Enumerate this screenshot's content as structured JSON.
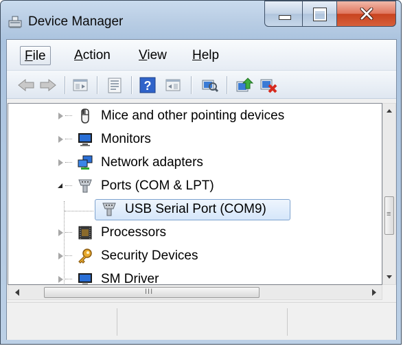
{
  "window": {
    "title": "Device Manager",
    "icon": "device-manager-icon",
    "caption_buttons": [
      "minimize",
      "maximize",
      "close"
    ]
  },
  "menu": {
    "items": [
      {
        "label": "File",
        "mnemonic": "F",
        "rest": "ile",
        "active": true
      },
      {
        "label": "Action",
        "mnemonic": "A",
        "rest": "ction",
        "active": false
      },
      {
        "label": "View",
        "mnemonic": "V",
        "rest": "iew",
        "active": false
      },
      {
        "label": "Help",
        "mnemonic": "H",
        "rest": "elp",
        "active": false
      }
    ]
  },
  "toolbar": {
    "buttons": [
      "back-icon",
      "forward-icon",
      "show-hide-console-tree-icon",
      "properties-icon",
      "help-icon",
      "show-action-pane-icon",
      "scan-hardware-icon",
      "update-driver-icon",
      "uninstall-device-icon"
    ]
  },
  "tree": {
    "nodes": [
      {
        "label": "Mice and other pointing devices",
        "icon": "mouse-icon",
        "expanded": false,
        "level": 0
      },
      {
        "label": "Monitors",
        "icon": "monitor-icon",
        "expanded": false,
        "level": 0
      },
      {
        "label": "Network adapters",
        "icon": "network-adapter-icon",
        "expanded": false,
        "level": 0
      },
      {
        "label": "Ports (COM & LPT)",
        "icon": "port-icon",
        "expanded": true,
        "level": 0
      },
      {
        "label": "USB Serial Port (COM9)",
        "icon": "port-icon",
        "expanded": null,
        "level": 1,
        "selected": true
      },
      {
        "label": "Processors",
        "icon": "processor-icon",
        "expanded": false,
        "level": 0
      },
      {
        "label": "Security Devices",
        "icon": "key-icon",
        "expanded": false,
        "level": 0
      },
      {
        "label": "SM Driver",
        "icon": "monitor-icon",
        "expanded": false,
        "level": 0
      }
    ]
  },
  "scrollbars": {
    "vertical_grip": "≡",
    "horizontal_grip": "III"
  },
  "colors": {
    "selection_border": "#7da2ce",
    "selection_fill": "#d5e6fa",
    "close_button": "#c8421f"
  }
}
